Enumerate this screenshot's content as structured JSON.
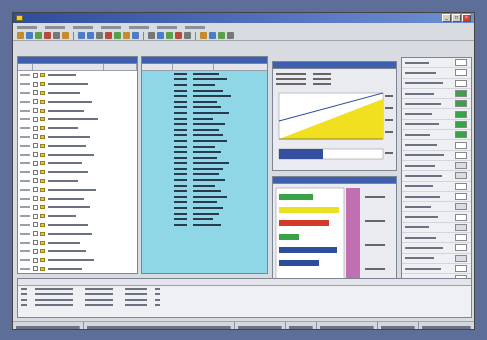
{
  "window": {
    "title": ""
  },
  "menubar": {
    "items": [
      "",
      "",
      "",
      "",
      "",
      "",
      ""
    ]
  },
  "toolbar": {
    "button_count": 22
  },
  "tree": {
    "rows": 24,
    "colors": {
      "folder": "#e2c34a",
      "background": "#ffffff"
    }
  },
  "list": {
    "rows": 28,
    "colors": {
      "background": "#8fd7e6"
    }
  },
  "chart_panel": {
    "colors": {
      "fill": "#f0e020",
      "bar": "#334f9e"
    }
  },
  "gantt_panel": {
    "colors": {
      "green": "#39a246",
      "yellow": "#e8e020",
      "red": "#d33a2a",
      "blue": "#2d4d9e",
      "pink": "#c06fb0"
    }
  },
  "properties": {
    "rows": 22
  },
  "bottom_table": {
    "rows": 4
  },
  "status_bar": {
    "fields": 7
  },
  "theme": {
    "titlebar": "#2f4d9a",
    "window_bg": "#d8dbe0",
    "desktop_bg": "#5d6f98"
  }
}
